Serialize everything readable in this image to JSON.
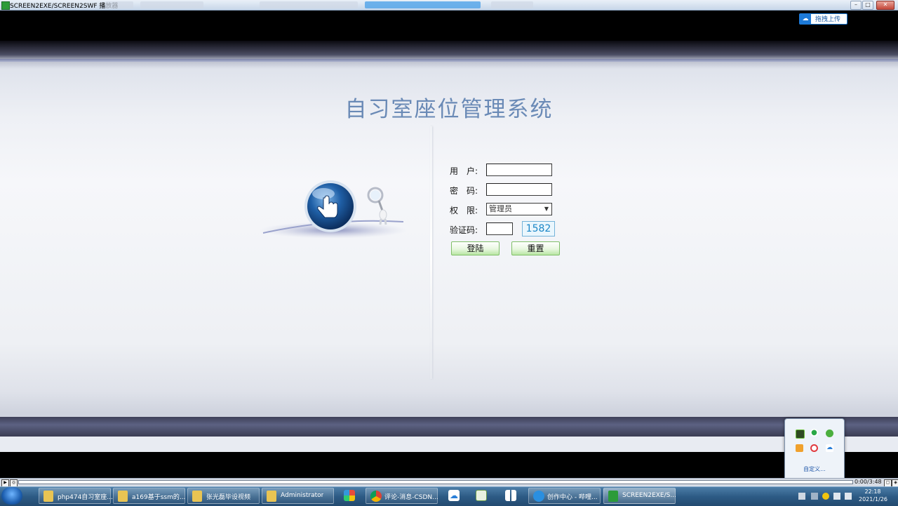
{
  "window": {
    "title": "SCREEN2EXE/SCREEN2SWF 播放器",
    "minimize_glyph": "–",
    "maximize_glyph": "□",
    "close_glyph": "✕"
  },
  "upload": {
    "label": "拖拽上传",
    "icon": "cloud-icon"
  },
  "page": {
    "system_title": "自习室座位管理系统"
  },
  "login_form": {
    "user_label": "用　户:",
    "password_label": "密　码:",
    "role_label": "权　限:",
    "role_selected": "管理员",
    "captcha_label": "验证码:",
    "captcha_code": "1582",
    "login_button": "登陆",
    "reset_button": "重置"
  },
  "tray_popup": {
    "customize_label": "自定义...",
    "icons": [
      "nvidia-icon",
      "wechat-icon",
      "chat-icon",
      "orange-app-icon",
      "huawei-icon",
      "baidu-cloud-icon"
    ]
  },
  "player": {
    "timecode": "0:00/3:48",
    "progress": 0.0
  },
  "taskbar": {
    "items": [
      {
        "label": "php474自习室座...",
        "icon": "folder-icon"
      },
      {
        "label": "a169基于ssm的...",
        "icon": "folder-icon"
      },
      {
        "label": "张光磊毕设视频",
        "icon": "folder-icon"
      },
      {
        "label": "Administrator",
        "icon": "folder-icon"
      },
      {
        "label": "评论-消息-CSDN...",
        "icon": "chrome-icon"
      },
      {
        "label": "创作中心 - 哔哩...",
        "icon": "edge-icon"
      },
      {
        "label": "SCREEN2EXE/S...",
        "icon": "screen2exe-icon"
      }
    ],
    "clock_time": "22:18",
    "clock_date": "2021/1/26"
  },
  "colors": {
    "title": "#6a8ab6",
    "captcha": "#1a86c7",
    "button_green": "#b9e6a4",
    "taskbar": "#2d5b85"
  }
}
